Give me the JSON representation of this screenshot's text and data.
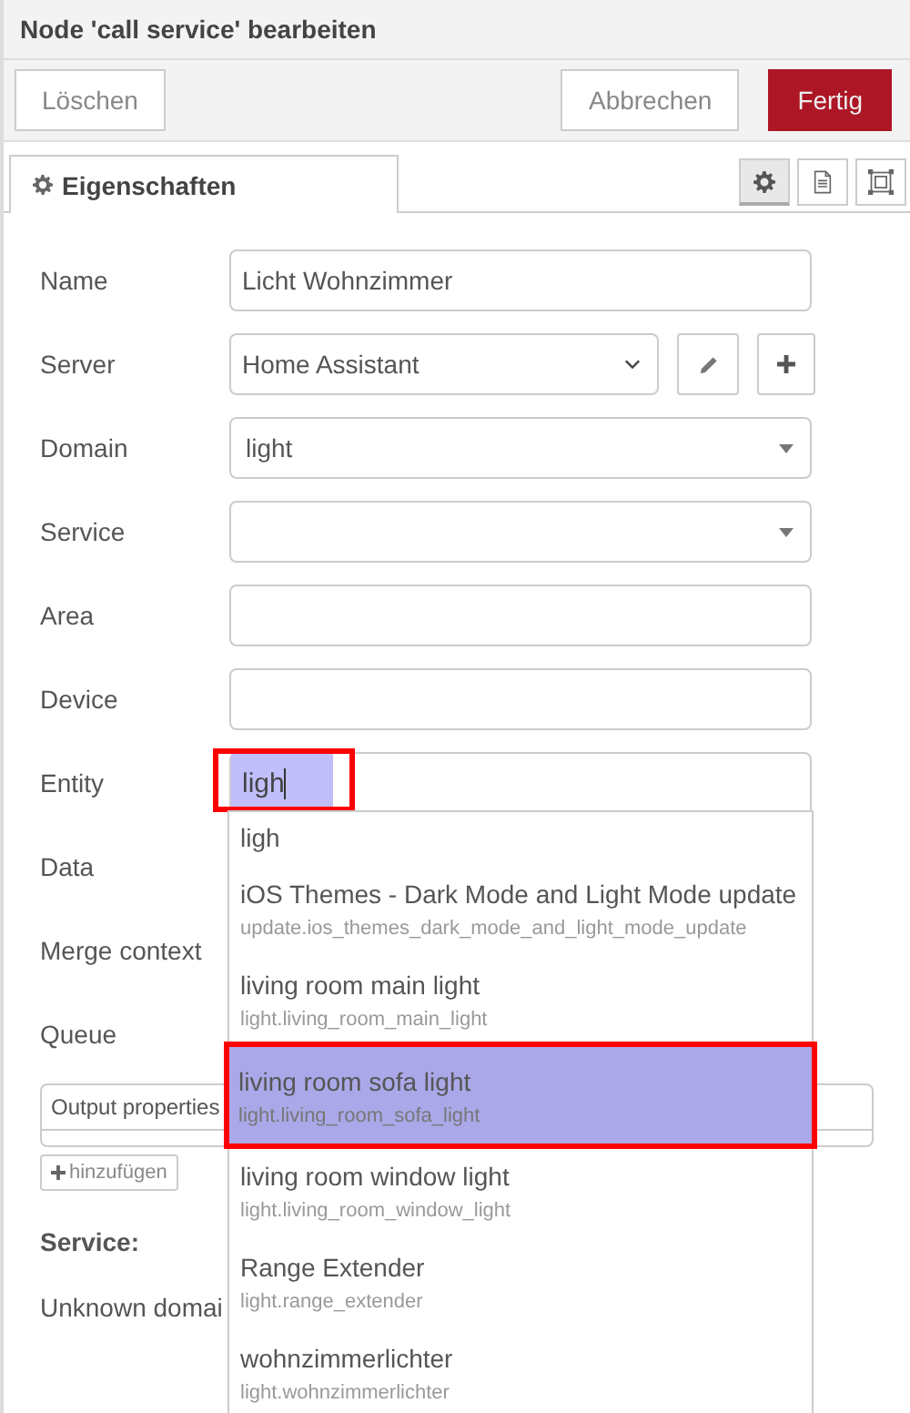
{
  "title": "Node 'call service' bearbeiten",
  "actions": [
    {
      "label": "Löschen",
      "kind": "plain"
    },
    {
      "label": "Abbrechen",
      "kind": "plain"
    },
    {
      "label": "Fertig",
      "kind": "primary"
    }
  ],
  "tabs": [
    {
      "label": "Eigenschaften",
      "selected": true
    }
  ],
  "tab_tools": [
    {
      "kind": "settings",
      "selected": true
    },
    {
      "kind": "document",
      "selected": false
    },
    {
      "kind": "frame",
      "selected": false
    }
  ],
  "fields": [
    {
      "label": "Name",
      "kind": "text",
      "value": "Licht Wohnzimmer"
    },
    {
      "label": "Server",
      "kind": "select-buttons",
      "value": "Home Assistant"
    },
    {
      "label": "Domain",
      "kind": "combo",
      "value": "light"
    },
    {
      "label": "Service",
      "kind": "combo"
    },
    {
      "label": "Area",
      "kind": "text"
    },
    {
      "label": "Device",
      "kind": "text"
    },
    {
      "label": "Entity",
      "kind": "autocomplete",
      "value": "ligh",
      "highlighted": true
    },
    {
      "label": "Data",
      "kind": "covered"
    },
    {
      "label": "Merge context",
      "kind": "covered"
    },
    {
      "label": "Queue",
      "kind": "covered"
    }
  ],
  "output_properties": {
    "header": "Output properties",
    "add_button": "hinzufügen"
  },
  "service_heading": "Service:",
  "service_note": "Unknown domai",
  "suggestions": [
    {
      "title": "ligh",
      "selected": false,
      "highlighted": false
    },
    {
      "title": "iOS Themes - Dark Mode and Light Mode update",
      "subtitle": "update.ios_themes_dark_mode_and_light_mode_update",
      "selected": false,
      "highlighted": false
    },
    {
      "title": "living room main light",
      "subtitle": "light.living_room_main_light",
      "selected": false,
      "highlighted": false
    },
    {
      "title": "living room sofa light",
      "subtitle": "light.living_room_sofa_light",
      "selected": true,
      "highlighted": true
    },
    {
      "title": "living room window light",
      "subtitle": "light.living_room_window_light",
      "selected": false,
      "highlighted": false
    },
    {
      "title": "Range Extender",
      "subtitle": "light.range_extender",
      "selected": false,
      "highlighted": false
    },
    {
      "title": "wohnzimmerlichter",
      "subtitle": "light.wohnzimmerlichter",
      "selected": false,
      "highlighted": false
    }
  ]
}
